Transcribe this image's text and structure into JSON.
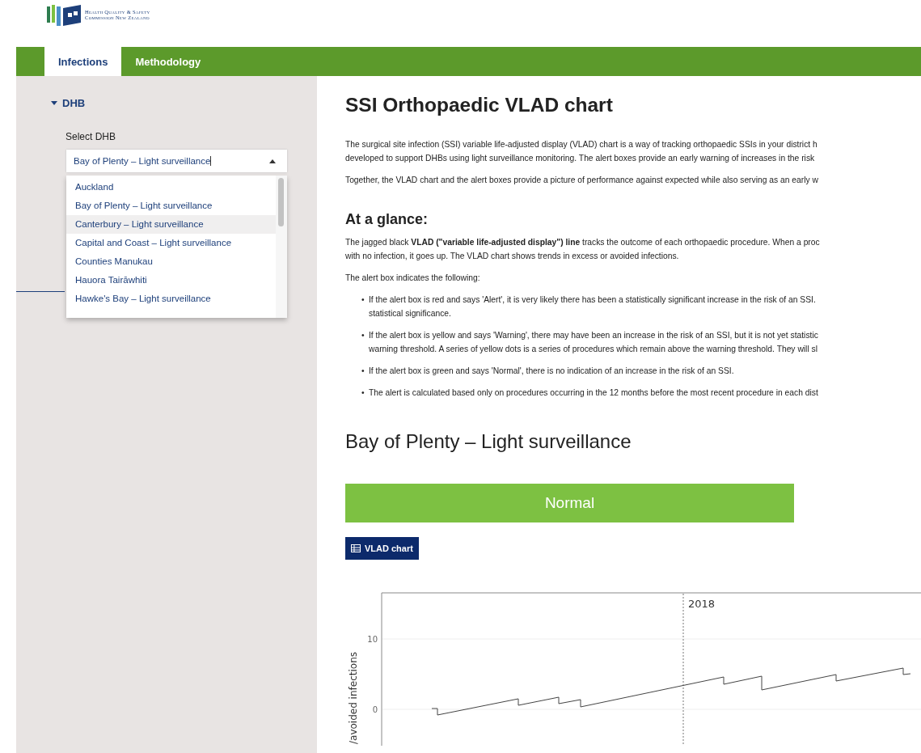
{
  "header": {
    "logo_lines": [
      "Health Quality & Safety",
      "Commission New Zealand"
    ]
  },
  "tabs": [
    {
      "label": "Infections",
      "selected": true
    },
    {
      "label": "Methodology",
      "selected": false
    }
  ],
  "sidebar": {
    "section": {
      "label": "DHB",
      "expanded": true
    },
    "select_label": "Select DHB",
    "select_value": "Bay of Plenty – Light surveillance",
    "dropdown_open": true,
    "options": [
      {
        "label": "Auckland",
        "highlighted": false
      },
      {
        "label": "Bay of Plenty – Light surveillance",
        "highlighted": false
      },
      {
        "label": "Canterbury – Light surveillance",
        "highlighted": true
      },
      {
        "label": "Capital and Coast – Light surveillance",
        "highlighted": false
      },
      {
        "label": "Counties Manukau",
        "highlighted": false
      },
      {
        "label": "Hauora Tairāwhiti",
        "highlighted": false
      },
      {
        "label": "Hawke's Bay – Light surveillance",
        "highlighted": false
      }
    ]
  },
  "main": {
    "title": "SSI Orthopaedic VLAD chart",
    "intro": [
      [
        "The surgical site infection (SSI) variable life-adjusted display (VLAD) chart is a way of tracking orthopaedic SSIs in your district h",
        "developed to support DHBs using light surveillance monitoring. The alert boxes provide an early warning of increases in the risk"
      ],
      [
        "Together, the VLAD chart and the alert boxes provide a picture of performance against expected while also serving as an early w"
      ]
    ],
    "glance_heading": "At a glance:",
    "glance": [
      [
        "The jagged black **VLAD (\"variable life-adjusted display\") line** tracks the outcome of each orthopaedic procedure. When a proc",
        "with no infection, it goes up. The VLAD chart shows trends in excess or avoided infections."
      ],
      [
        "The alert box indicates the following:"
      ]
    ],
    "bullets": [
      {
        "marker": "•",
        "lines": [
          "If the alert box is red and says 'Alert', it is very likely there has been a statistically significant increase in the risk of an SSI.",
          "statistical significance."
        ]
      },
      {
        "marker": "•",
        "lines": [
          "If the alert box is yellow and says 'Warning', there may have been an increase in the risk of an SSI, but it is not yet statistic",
          "warning threshold. A series of yellow dots is a series of procedures which remain above the warning threshold. They will sl"
        ]
      },
      {
        "marker": "•",
        "lines": [
          "If the alert box is green and says 'Normal', there is no indication of an increase in the risk of an SSI."
        ]
      },
      {
        "marker": "•",
        "lines": [
          "The alert is calculated based only on procedures occurring in the 12 months before the most recent procedure in each dist"
        ]
      }
    ],
    "region_heading": "Bay of Plenty – Light surveillance",
    "alert": {
      "label": "Normal",
      "color": "#7dc142"
    },
    "chart_button": "VLAD chart",
    "chart": {
      "ylabel": "/avoided infections",
      "yticks": [
        "10",
        "0"
      ],
      "marker_label": "2018"
    }
  }
}
